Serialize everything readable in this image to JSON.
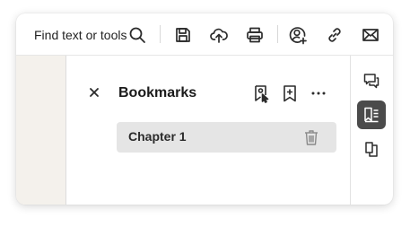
{
  "toolbar": {
    "search_label": "Find text or tools",
    "icons": [
      "search-icon",
      "save-icon",
      "upload-icon",
      "print-icon",
      "add-user-icon",
      "link-icon",
      "mail-icon"
    ]
  },
  "panel": {
    "title": "Bookmarks",
    "header_icons": [
      "bookmark-from-selection-icon",
      "add-bookmark-icon",
      "more-icon"
    ]
  },
  "bookmarks": [
    {
      "label": "Chapter 1",
      "selected": true
    }
  ],
  "right_rail": {
    "items": [
      {
        "icon": "comment-icon",
        "active": false
      },
      {
        "icon": "bookmarks-icon",
        "active": true
      },
      {
        "icon": "pages-icon",
        "active": false
      }
    ]
  },
  "colors": {
    "active_rail_bg": "#4b4b4b",
    "selected_row_bg": "#e5e5e5",
    "left_strip_bg": "#f4f1ec"
  }
}
